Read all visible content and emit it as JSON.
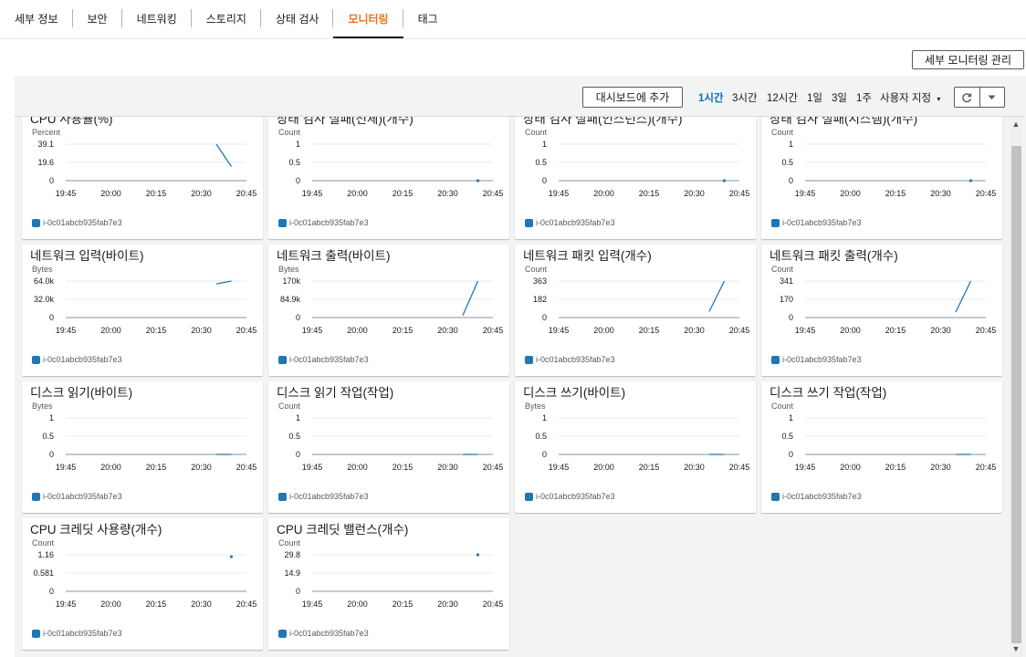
{
  "tabs": [
    {
      "label": "세부 정보",
      "active": false
    },
    {
      "label": "보안",
      "active": false
    },
    {
      "label": "네트워킹",
      "active": false
    },
    {
      "label": "스토리지",
      "active": false
    },
    {
      "label": "상태 검사",
      "active": false
    },
    {
      "label": "모니터링",
      "active": true
    },
    {
      "label": "태그",
      "active": false
    }
  ],
  "manage_button": "세부 모니터링 관리",
  "toolbar": {
    "add_dashboard": "대시보드에 추가",
    "ranges": [
      {
        "label": "1시간",
        "active": true
      },
      {
        "label": "3시간",
        "active": false
      },
      {
        "label": "12시간",
        "active": false
      },
      {
        "label": "1일",
        "active": false
      },
      {
        "label": "3일",
        "active": false
      },
      {
        "label": "1주",
        "active": false
      }
    ],
    "custom_range": "사용자 지정",
    "refresh_icon": "refresh-icon",
    "dropdown_icon": "caret-down-icon"
  },
  "legend_instance": "i-0c01abcb935fab7e3",
  "accent_color": "#ec7211",
  "series_color": "#1f77b4",
  "chart_data": [
    {
      "type": "line",
      "title": "CPU 사용률(%)",
      "unit": "Percent",
      "yticks": [
        "0",
        "19.6",
        "39.1"
      ],
      "ylim": [
        0,
        39.1
      ],
      "xticks": [
        "19:45",
        "20:00",
        "20:15",
        "20:30",
        "20:45"
      ],
      "series": [
        {
          "name": "i-0c01abcb935fab7e3",
          "x": [
            "20:35",
            "20:40"
          ],
          "y": [
            39.1,
            15.0
          ]
        }
      ]
    },
    {
      "type": "line",
      "title": "상태 검사 실패(전체)(개수)",
      "unit": "Count",
      "yticks": [
        "0",
        "0.5",
        "1"
      ],
      "ylim": [
        0,
        1
      ],
      "xticks": [
        "19:45",
        "20:00",
        "20:15",
        "20:30",
        "20:45"
      ],
      "series": [
        {
          "name": "i-0c01abcb935fab7e3",
          "x": [
            "20:40"
          ],
          "y": [
            0
          ]
        }
      ]
    },
    {
      "type": "line",
      "title": "상태 검사 실패(인스턴스)(개수)",
      "unit": "Count",
      "yticks": [
        "0",
        "0.5",
        "1"
      ],
      "ylim": [
        0,
        1
      ],
      "xticks": [
        "19:45",
        "20:00",
        "20:15",
        "20:30",
        "20:45"
      ],
      "series": [
        {
          "name": "i-0c01abcb935fab7e3",
          "x": [
            "20:40"
          ],
          "y": [
            0
          ]
        }
      ]
    },
    {
      "type": "line",
      "title": "상태 검사 실패(시스템)(개수)",
      "unit": "Count",
      "yticks": [
        "0",
        "0.5",
        "1"
      ],
      "ylim": [
        0,
        1
      ],
      "xticks": [
        "19:45",
        "20:00",
        "20:15",
        "20:30",
        "20:45"
      ],
      "series": [
        {
          "name": "i-0c01abcb935fab7e3",
          "x": [
            "20:40"
          ],
          "y": [
            0
          ]
        }
      ]
    },
    {
      "type": "line",
      "title": "네트워크 입력(바이트)",
      "unit": "Bytes",
      "yticks": [
        "0",
        "32.0k",
        "64.0k"
      ],
      "ylim": [
        0,
        64000
      ],
      "xticks": [
        "19:45",
        "20:00",
        "20:15",
        "20:30",
        "20:45"
      ],
      "series": [
        {
          "name": "i-0c01abcb935fab7e3",
          "x": [
            "20:35",
            "20:40"
          ],
          "y": [
            59000,
            64000
          ]
        }
      ]
    },
    {
      "type": "line",
      "title": "네트워크 출력(바이트)",
      "unit": "Bytes",
      "yticks": [
        "0",
        "84.9k",
        "170k"
      ],
      "ylim": [
        0,
        170000
      ],
      "xticks": [
        "19:45",
        "20:00",
        "20:15",
        "20:30",
        "20:45"
      ],
      "series": [
        {
          "name": "i-0c01abcb935fab7e3",
          "x": [
            "20:35",
            "20:40"
          ],
          "y": [
            10000,
            170000
          ]
        }
      ]
    },
    {
      "type": "line",
      "title": "네트워크 패킷 입력(개수)",
      "unit": "Count",
      "yticks": [
        "0",
        "182",
        "363"
      ],
      "ylim": [
        0,
        363
      ],
      "xticks": [
        "19:45",
        "20:00",
        "20:15",
        "20:30",
        "20:45"
      ],
      "series": [
        {
          "name": "i-0c01abcb935fab7e3",
          "x": [
            "20:35",
            "20:40"
          ],
          "y": [
            60,
            363
          ]
        }
      ]
    },
    {
      "type": "line",
      "title": "네트워크 패킷 출력(개수)",
      "unit": "Count",
      "yticks": [
        "0",
        "170",
        "341"
      ],
      "ylim": [
        0,
        341
      ],
      "xticks": [
        "19:45",
        "20:00",
        "20:15",
        "20:30",
        "20:45"
      ],
      "series": [
        {
          "name": "i-0c01abcb935fab7e3",
          "x": [
            "20:35",
            "20:40"
          ],
          "y": [
            50,
            341
          ]
        }
      ]
    },
    {
      "type": "line",
      "title": "디스크 읽기(바이트)",
      "unit": "Bytes",
      "yticks": [
        "0",
        "0.5",
        "1"
      ],
      "ylim": [
        0,
        1
      ],
      "xticks": [
        "19:45",
        "20:00",
        "20:15",
        "20:30",
        "20:45"
      ],
      "series": [
        {
          "name": "i-0c01abcb935fab7e3",
          "x": [
            "20:35",
            "20:40"
          ],
          "y": [
            0,
            0
          ]
        }
      ]
    },
    {
      "type": "line",
      "title": "디스크 읽기 작업(작업)",
      "unit": "Count",
      "yticks": [
        "0",
        "0.5",
        "1"
      ],
      "ylim": [
        0,
        1
      ],
      "xticks": [
        "19:45",
        "20:00",
        "20:15",
        "20:30",
        "20:45"
      ],
      "series": [
        {
          "name": "i-0c01abcb935fab7e3",
          "x": [
            "20:35",
            "20:40"
          ],
          "y": [
            0,
            0
          ]
        }
      ]
    },
    {
      "type": "line",
      "title": "디스크 쓰기(바이트)",
      "unit": "Bytes",
      "yticks": [
        "0",
        "0.5",
        "1"
      ],
      "ylim": [
        0,
        1
      ],
      "xticks": [
        "19:45",
        "20:00",
        "20:15",
        "20:30",
        "20:45"
      ],
      "series": [
        {
          "name": "i-0c01abcb935fab7e3",
          "x": [
            "20:35",
            "20:40"
          ],
          "y": [
            0,
            0
          ]
        }
      ]
    },
    {
      "type": "line",
      "title": "디스크 쓰기 작업(작업)",
      "unit": "Count",
      "yticks": [
        "0",
        "0.5",
        "1"
      ],
      "ylim": [
        0,
        1
      ],
      "xticks": [
        "19:45",
        "20:00",
        "20:15",
        "20:30",
        "20:45"
      ],
      "series": [
        {
          "name": "i-0c01abcb935fab7e3",
          "x": [
            "20:35",
            "20:40"
          ],
          "y": [
            0,
            0
          ]
        }
      ]
    },
    {
      "type": "line",
      "title": "CPU 크레딧 사용량(개수)",
      "unit": "Count",
      "yticks": [
        "0",
        "0.581",
        "1.16"
      ],
      "ylim": [
        0,
        1.16
      ],
      "xticks": [
        "19:45",
        "20:00",
        "20:15",
        "20:30",
        "20:45"
      ],
      "series": [
        {
          "name": "i-0c01abcb935fab7e3",
          "x": [
            "20:40"
          ],
          "y": [
            1.1
          ]
        }
      ]
    },
    {
      "type": "line",
      "title": "CPU 크레딧 밸런스(개수)",
      "unit": "Count",
      "yticks": [
        "0",
        "14.9",
        "29.8"
      ],
      "ylim": [
        0,
        29.8
      ],
      "xticks": [
        "19:45",
        "20:00",
        "20:15",
        "20:30",
        "20:45"
      ],
      "series": [
        {
          "name": "i-0c01abcb935fab7e3",
          "x": [
            "20:40"
          ],
          "y": [
            29.8
          ]
        }
      ]
    }
  ]
}
